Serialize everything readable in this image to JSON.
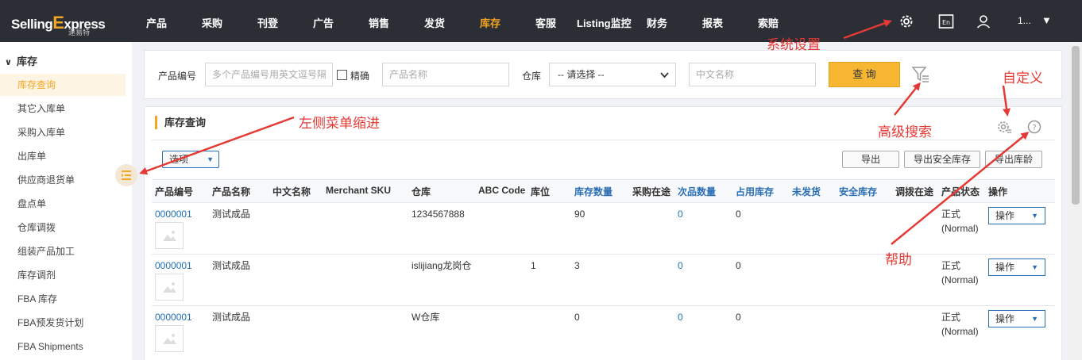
{
  "brand": {
    "logo_main": "Selling",
    "logo_x": "E",
    "logo_tail": "xpress",
    "logo_sub": "速易特"
  },
  "nav": {
    "items": [
      "产品",
      "采购",
      "刊登",
      "广告",
      "销售",
      "发货",
      "库存",
      "客服",
      "Listing监控",
      "财务",
      "报表",
      "索赔"
    ],
    "active": "库存",
    "user_text": "1...",
    "caret": "▼"
  },
  "sidebar": {
    "header": "库存",
    "items": [
      "库存查询",
      "其它入库单",
      "采购入库单",
      "出库单",
      "供应商退货单",
      "盘点单",
      "仓库调拨",
      "组装产品加工",
      "库存调剂",
      "FBA 库存",
      "FBA预发货计划",
      "FBA Shipments"
    ],
    "active_index": 0
  },
  "search": {
    "product_no_label": "产品编号",
    "product_no_placeholder": "多个产品编号用英文逗号隔开",
    "exact_label": "精确",
    "product_name_placeholder": "产品名称",
    "warehouse_label": "仓库",
    "warehouse_value": "-- 请选择 --",
    "cn_name_placeholder": "中文名称",
    "query_button": "查 询"
  },
  "section": {
    "title": "库存查询"
  },
  "toolbar": {
    "options_label": "选项",
    "export": "导出",
    "export_safe": "导出安全库存",
    "export_age": "导出库龄"
  },
  "table": {
    "headers": [
      "产品编号",
      "产品名称",
      "中文名称",
      "Merchant SKU",
      "仓库",
      "ABC Code",
      "库位",
      "库存数量",
      "采购在途",
      "次品数量",
      "占用库存",
      "未发货",
      "安全库存",
      "调拨在途",
      "产品状态",
      "操作"
    ],
    "rows": [
      {
        "product_no": "0000001",
        "product_name": "测试成品",
        "warehouse": "1234567888",
        "location": "",
        "stock": "90",
        "defective": "0",
        "occupied": "0",
        "status": "正式",
        "status_en": "(Normal)",
        "op": "操作"
      },
      {
        "product_no": "0000001",
        "product_name": "测试成品",
        "warehouse": "islijiang龙岗仓",
        "location": "1",
        "stock": "3",
        "defective": "0",
        "occupied": "0",
        "status": "正式",
        "status_en": "(Normal)",
        "op": "操作"
      },
      {
        "product_no": "0000001",
        "product_name": "测试成品",
        "warehouse": "W仓库",
        "location": "",
        "stock": "0",
        "defective": "0",
        "occupied": "0",
        "status": "正式",
        "status_en": "(Normal)",
        "op": "操作"
      }
    ]
  },
  "annotations": {
    "system_settings": "系统设置",
    "custom": "自定义",
    "left_menu": "左侧菜单缩进",
    "advanced_search": "高级搜索",
    "help": "帮助"
  },
  "colors": {
    "accent": "#f5a623",
    "link": "#1f6fb7",
    "annotation": "#e53935",
    "topbar": "#2b2e35"
  }
}
